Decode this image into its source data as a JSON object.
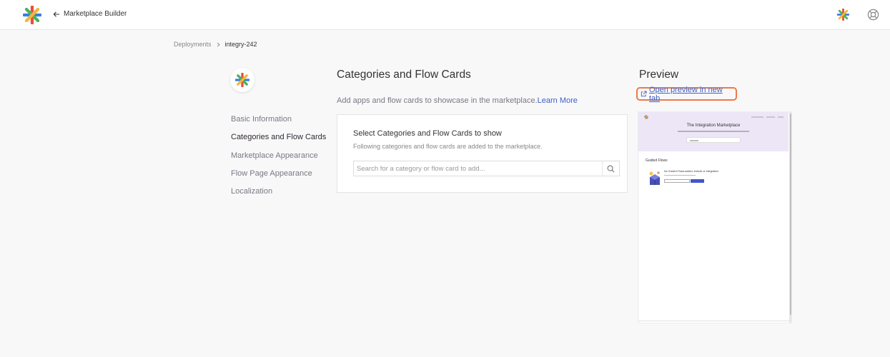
{
  "header": {
    "back_label": "Marketplace Builder"
  },
  "breadcrumb": {
    "items": [
      "Deployments",
      "integry-242"
    ]
  },
  "sidebar": {
    "items": [
      {
        "label": "Basic Information"
      },
      {
        "label": "Categories and Flow Cards",
        "active": true
      },
      {
        "label": "Marketplace Appearance"
      },
      {
        "label": "Flow Page Appearance"
      },
      {
        "label": "Localization"
      }
    ]
  },
  "section": {
    "title": "Categories and Flow Cards",
    "description": "Add apps and flow cards to showcase in the marketplace.",
    "learn_more": "Learn More"
  },
  "card": {
    "title": "Select Categories and Flow Cards to show",
    "subtitle": "Following categories and flow cards are added to the marketplace.",
    "search_placeholder": "Search for a category or flow card to add..."
  },
  "preview": {
    "title": "Preview",
    "link": "Open preview in new tab",
    "hero_title": "The Integration Marketplace",
    "guided_title": "Guided Flows",
    "guided_empty": "No Guided Flows added, include or integration"
  },
  "colors": {
    "accent": "#3d5fc4",
    "highlight": "#ef7a45",
    "hero_bg": "#ede6f7",
    "button": "#4355c8"
  },
  "icons": {
    "logo": "asterisk-logo-icon",
    "back": "arrow-left-icon",
    "help": "life-ring-icon",
    "search": "search-icon",
    "external": "external-link-icon"
  }
}
